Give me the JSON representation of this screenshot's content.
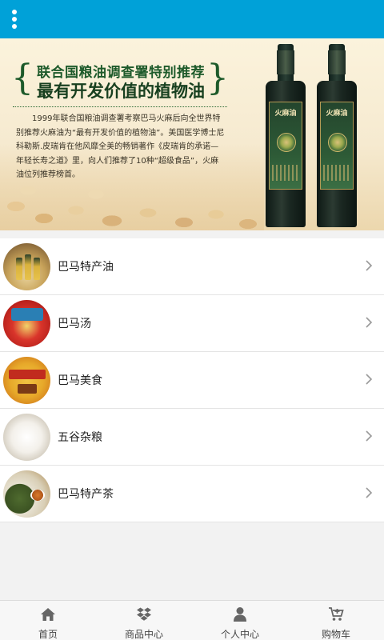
{
  "header": {
    "menu_icon": "more-vertical-icon",
    "background_color": "#00a1d8"
  },
  "banner": {
    "heading_line1": "联合国粮油调查署特别推荐",
    "heading_line2": "最有开发价值的植物油",
    "body": "1999年联合国粮油调查署考察巴马火麻后向全世界特别推荐火麻油为“最有开发价值的植物油”。美国医学博士尼科勒斯.皮瑞肯在他风靡全美的畅销著作《皮瑞肯的承诺—年轻长寿之道》里，向人们推荐了10种“超级食品”，火麻油位列推荐榜首。",
    "bottle_label": "火麻油",
    "slide_count": 3,
    "active_slide": 2
  },
  "categories": [
    {
      "label": "巴马特产油",
      "thumb": "oil-gift-box-image",
      "chevron": "chevron-right-icon"
    },
    {
      "label": "巴马汤",
      "thumb": "soup-package-image",
      "chevron": "chevron-right-icon"
    },
    {
      "label": "巴马美食",
      "thumb": "local-food-image",
      "chevron": "chevron-right-icon"
    },
    {
      "label": "五谷杂粮",
      "thumb": "grain-bowl-image",
      "chevron": "chevron-right-icon"
    },
    {
      "label": "巴马特产茶",
      "thumb": "tea-image",
      "chevron": "chevron-right-icon"
    }
  ],
  "tabbar": {
    "tabs": [
      {
        "label": "首页",
        "icon": "home-icon"
      },
      {
        "label": "商品中心",
        "icon": "dropbox-icon"
      },
      {
        "label": "个人中心",
        "icon": "user-icon"
      },
      {
        "label": "购物车",
        "icon": "cart-plus-icon"
      }
    ]
  },
  "colors": {
    "accent": "#00a1d8",
    "banner_title": "#1d5a2a",
    "tab_icon": "#666666",
    "chevron": "#999999"
  }
}
